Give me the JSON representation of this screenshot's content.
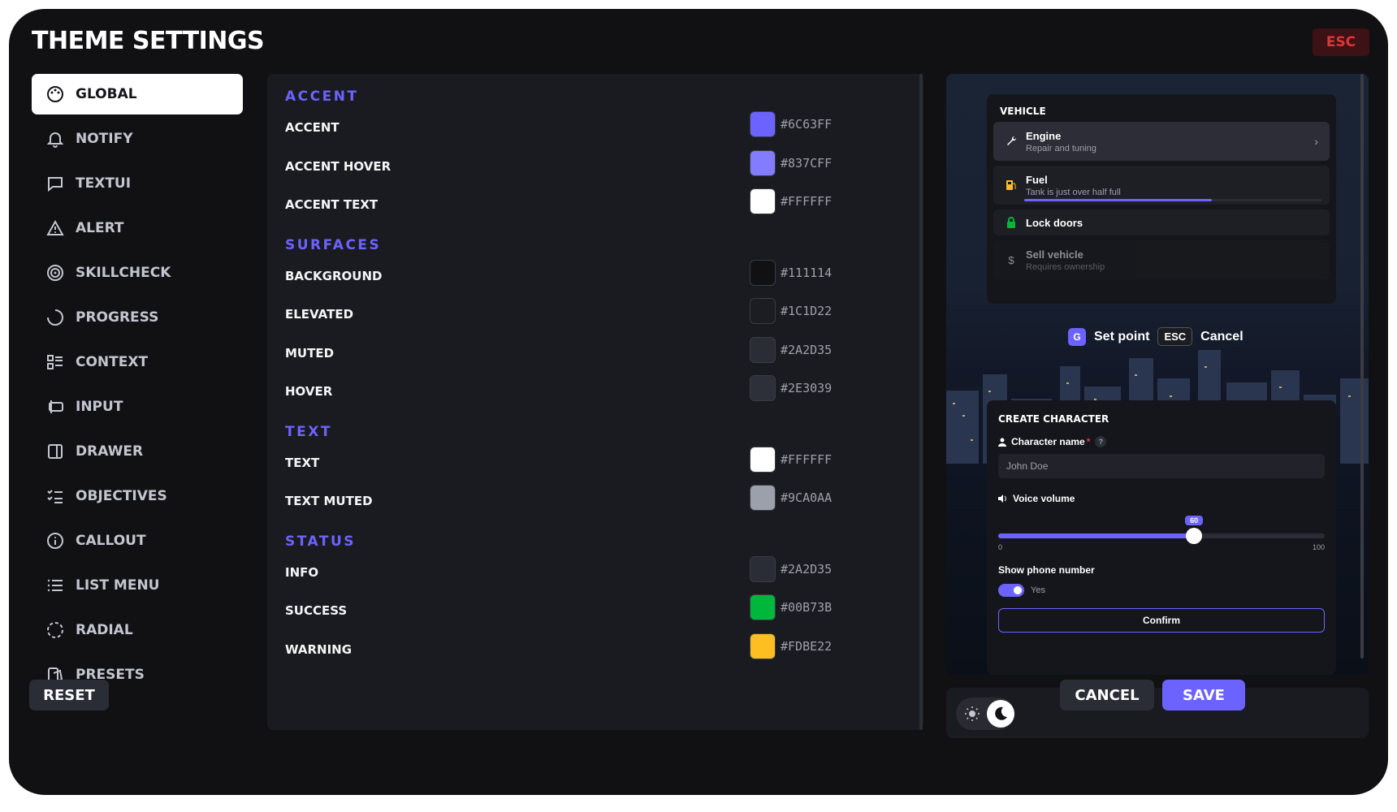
{
  "title": "THEME SETTINGS",
  "esc_label": "ESC",
  "nav": [
    {
      "label": "GLOBAL",
      "icon": "palette-icon",
      "active": true
    },
    {
      "label": "NOTIFY",
      "icon": "bell-icon"
    },
    {
      "label": "TEXTUI",
      "icon": "message-icon"
    },
    {
      "label": "ALERT",
      "icon": "warning-icon"
    },
    {
      "label": "SKILLCHECK",
      "icon": "target-icon"
    },
    {
      "label": "PROGRESS",
      "icon": "progress-icon"
    },
    {
      "label": "CONTEXT",
      "icon": "context-icon"
    },
    {
      "label": "INPUT",
      "icon": "input-icon"
    },
    {
      "label": "DRAWER",
      "icon": "drawer-icon"
    },
    {
      "label": "OBJECTIVES",
      "icon": "checklist-icon"
    },
    {
      "label": "CALLOUT",
      "icon": "info-icon"
    },
    {
      "label": "LIST MENU",
      "icon": "list-icon"
    },
    {
      "label": "RADIAL",
      "icon": "radial-icon"
    },
    {
      "label": "PRESETS",
      "icon": "presets-icon"
    }
  ],
  "sections": [
    {
      "title": "ACCENT",
      "rows": [
        {
          "label": "ACCENT",
          "color": "#6C63FF",
          "hex": "#6C63FF"
        },
        {
          "label": "ACCENT HOVER",
          "color": "#837CFF",
          "hex": "#837CFF"
        },
        {
          "label": "ACCENT TEXT",
          "color": "#FFFFFF",
          "hex": "#FFFFFF"
        }
      ]
    },
    {
      "title": "SURFACES",
      "rows": [
        {
          "label": "BACKGROUND",
          "color": "#111114",
          "hex": "#111114"
        },
        {
          "label": "ELEVATED",
          "color": "#1C1D22",
          "hex": "#1C1D22"
        },
        {
          "label": "MUTED",
          "color": "#2A2D35",
          "hex": "#2A2D35"
        },
        {
          "label": "HOVER",
          "color": "#2E3039",
          "hex": "#2E3039"
        }
      ]
    },
    {
      "title": "TEXT",
      "rows": [
        {
          "label": "TEXT",
          "color": "#FFFFFF",
          "hex": "#FFFFFF"
        },
        {
          "label": "TEXT MUTED",
          "color": "#9CA0AA",
          "hex": "#9CA0AA"
        }
      ]
    },
    {
      "title": "STATUS",
      "rows": [
        {
          "label": "INFO",
          "color": "#2A2D35",
          "hex": "#2A2D35"
        },
        {
          "label": "SUCCESS",
          "color": "#00B73B",
          "hex": "#00B73B"
        },
        {
          "label": "WARNING",
          "color": "#FDBE22",
          "hex": "#FDBE22"
        }
      ]
    }
  ],
  "preview": {
    "vehicle": {
      "header": "VEHICLE",
      "items": [
        {
          "title": "Engine",
          "subtitle": "Repair and tuning",
          "icon": "wrench-icon"
        },
        {
          "title": "Fuel",
          "subtitle": "Tank is just over half full",
          "icon": "fuel-icon",
          "progress": 0.63
        },
        {
          "title": "Lock doors",
          "subtitle": "",
          "icon": "lock-icon"
        },
        {
          "title": "Sell vehicle",
          "subtitle": "Requires ownership",
          "icon": "dollar-icon"
        }
      ]
    },
    "textui": {
      "key": "G",
      "action": "Set point",
      "key2": "ESC",
      "action2": "Cancel"
    },
    "create": {
      "header": "CREATE CHARACTER",
      "name_label": "Character name",
      "required_mark": "*",
      "help": "?",
      "name_value": "John Doe",
      "volume_label": "Voice volume",
      "volume_value": "60",
      "volume_fraction": 0.6,
      "min": "0",
      "max": "100",
      "phone_label": "Show phone number",
      "phone_toggle_label": "Yes",
      "confirm": "Confirm"
    }
  },
  "buttons": {
    "reset": "RESET",
    "cancel": "CANCEL",
    "save": "SAVE"
  },
  "colors": {
    "accent": "#6C63FF",
    "background": "#111114",
    "panel": "#1A1B20"
  }
}
